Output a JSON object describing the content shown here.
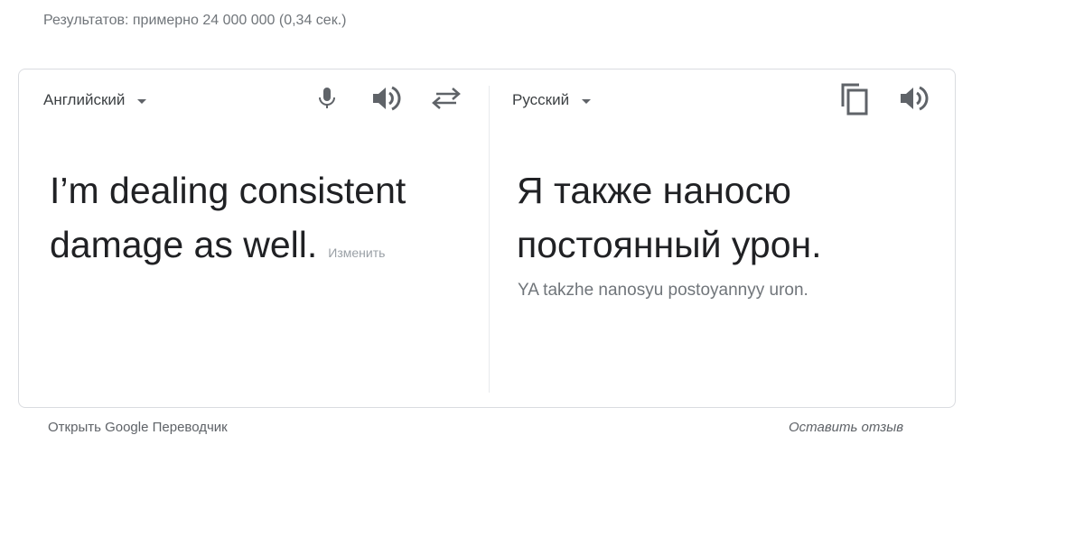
{
  "results_stats": "Результатов: примерно 24 000 000 (0,34 сек.)",
  "source": {
    "language": "Английский",
    "text": "I’m dealing consistent damage as well.",
    "edit_label": "Изменить"
  },
  "target": {
    "language": "Русский",
    "text": "Я также наносю постоянный урон.",
    "transliteration": "YA takzhe nanosyu postoyannyy uron."
  },
  "icons": {
    "mic": "microphone-icon",
    "speaker": "speaker-icon",
    "swap": "swap-languages-icon",
    "copy": "copy-icon"
  },
  "footer": {
    "open_translate": "Открыть Google Переводчик",
    "feedback": "Оставить отзыв"
  }
}
